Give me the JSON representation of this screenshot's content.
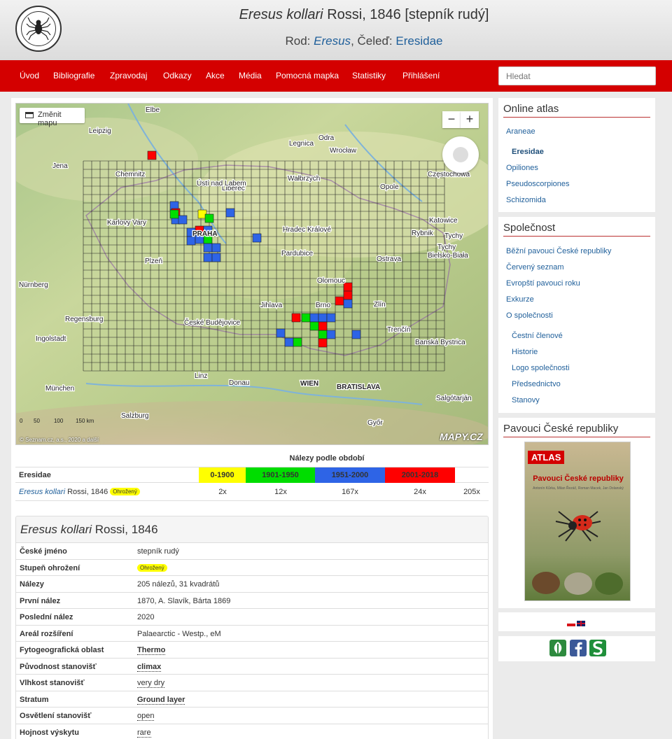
{
  "header": {
    "title_genus_species": "Eresus kollari",
    "title_rest": "Rossi, 1846 [stepník rudý]",
    "subtitle_rod_label": "Rod:",
    "subtitle_rod_value": "Eresus",
    "subtitle_celed_label": ", Čeleď:",
    "subtitle_celed_value": "Eresidae",
    "logo_text": "ČESKÁ ARACHNOLOGICKÁ SPOLEČNOST"
  },
  "nav": {
    "items": [
      "Úvod",
      "Bibliografie",
      "Zpravodaj",
      "Odkazy",
      "Akce",
      "Média",
      "Pomocná mapka",
      "Statistiky",
      "Přihlášení"
    ],
    "search_placeholder": "Hledat"
  },
  "map": {
    "change_map_label": "Změnit mapu",
    "zoom_minus": "−",
    "zoom_plus": "+",
    "brand": "MAPY.CZ",
    "copyright": "© Seznam.cz, a.s., 2020 a další",
    "scale_labels": [
      "0",
      "50",
      "100",
      "150 km"
    ],
    "cities": [
      "Leipzig",
      "Jena",
      "Chemnitz",
      "Liberec",
      "Wałbrzych",
      "Wrocław",
      "Opole",
      "Częstochowa",
      "Ústí nad Labem",
      "Karlovy Vary",
      "PRAHA",
      "Hradec Králové",
      "Pardubice",
      "Katowice",
      "Rybnik",
      "Tychy",
      "Bielsko-Biała",
      "Plzeň",
      "Ostrava",
      "Nürnberg",
      "Olomouc",
      "Jihlava",
      "Brno",
      "Zlín",
      "Regensburg",
      "České Budějovice",
      "Ingolstadt",
      "Linz",
      "WIEN",
      "BRATISLAVA",
      "München",
      "Salzburg",
      "Győr",
      "Elbe",
      "Odra",
      "Legnica",
      "Donau",
      "Trenčín",
      "Banská Bystrica",
      "Salgótarján",
      "Tychy"
    ]
  },
  "periods": {
    "heading": "Nálezy podle období",
    "family": "Eresidae",
    "columns": [
      {
        "label": "0-1900",
        "color": "#ffff00",
        "text_color": "#333333"
      },
      {
        "label": "1901-1950",
        "color": "#00dd00",
        "text_color": "#333333"
      },
      {
        "label": "1951-2000",
        "color": "#2e64e6",
        "text_color": "#333333"
      },
      {
        "label": "2001-2018",
        "color": "#ff0000",
        "text_color": "#333333"
      }
    ],
    "row": {
      "species_italic": "Eresus kollari",
      "author": "Rossi, 1846",
      "status_badge": "Ohrožený",
      "counts": [
        "2x",
        "12x",
        "167x",
        "24x",
        "205x"
      ]
    }
  },
  "details": {
    "title_italic": "Eresus kollari",
    "title_rest": "Rossi, 1846",
    "rows": [
      {
        "key": "České jméno",
        "value": "stepník rudý"
      },
      {
        "key": "Stupeň ohrožení",
        "value": "Ohrožený"
      },
      {
        "key": "Nálezy",
        "value": "205 nálezů, 31 kvadrátů"
      },
      {
        "key": "První nález",
        "value": "1870, A. Slavík, Bárta 1869"
      },
      {
        "key": "Poslední nález",
        "value": "2020"
      },
      {
        "key": "Areál rozšíření",
        "value": "Palaearctic - Westp., eM"
      },
      {
        "key": "Fytogeografická oblast",
        "value": "Thermo"
      },
      {
        "key": "Původnost stanovišť",
        "value": "climax"
      },
      {
        "key": "Vlhkost stanovišť",
        "value": "very dry"
      },
      {
        "key": "Stratum",
        "value": "Ground layer"
      },
      {
        "key": "Osvětlení stanovišť",
        "value": "open"
      },
      {
        "key": "Hojnost výskytu",
        "value": "rare"
      }
    ]
  },
  "sidebar": {
    "atlas_title": "Online atlas",
    "atlas_links": [
      "Araneae",
      "Eresidae",
      "Opiliones",
      "Pseudoscorpiones",
      "Schizomida"
    ],
    "society_title": "Společnost",
    "society_links": [
      "Běžní pavouci České republiky",
      "Červený seznam",
      "Evropští pavouci roku",
      "Exkurze",
      "O společnosti"
    ],
    "society_sublinks": [
      "Čestní členové",
      "Historie",
      "Logo společnosti",
      "Předsednictvo",
      "Stanovy"
    ],
    "book_panel_title": "Pavouci České republiky",
    "book_badge": "ATLAS",
    "book_title": "Pavouci České republiky",
    "book_authors": "Antonín Kůrka, Milan Řezáč, Roman Macek, Jan Dolanský",
    "social_icons": [
      "tree-icon",
      "facebook-icon",
      "s-logo-icon"
    ]
  }
}
